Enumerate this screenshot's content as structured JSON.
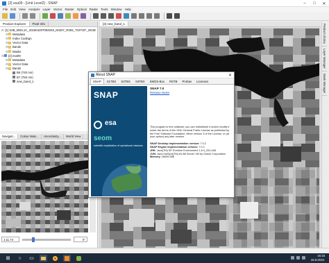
{
  "window": {
    "title": "[2] esa09 - [Unit Level2] - SNAP",
    "controls": [
      "–",
      "□",
      "✕"
    ]
  },
  "menu": [
    "File",
    "Edit",
    "View",
    "Analysis",
    "Layer",
    "Vector",
    "Raster",
    "Optical",
    "Radar",
    "Tools",
    "Window",
    "Help"
  ],
  "left_panel": {
    "tabs": [
      "Product Explorer",
      "Pixel Info"
    ],
    "tree": [
      {
        "label": "[1] S2B_MSIL1C_20180429T092029_N0207_R093_T34TGP_20180429",
        "depth": 0,
        "icon": "product-icon"
      },
      {
        "label": "Metadata",
        "depth": 1,
        "icon": "folder-icon"
      },
      {
        "label": "Index Codings",
        "depth": 1,
        "icon": "folder-icon"
      },
      {
        "label": "Vector Data",
        "depth": 1,
        "icon": "folder-icon"
      },
      {
        "label": "Bands",
        "depth": 1,
        "icon": "folder-icon"
      },
      {
        "label": "Masks",
        "depth": 1,
        "icon": "folder-icon"
      },
      {
        "label": "[2] esa09",
        "depth": 0,
        "icon": "product-icon"
      },
      {
        "label": "Metadata",
        "depth": 1,
        "icon": "folder-icon"
      },
      {
        "label": "Vector Data",
        "depth": 1,
        "icon": "folder-icon"
      },
      {
        "label": "Bands",
        "depth": 1,
        "icon": "folder-icon"
      },
      {
        "label": "B6 (740 nm)",
        "depth": 2,
        "icon": "band-icon"
      },
      {
        "label": "B7 (783 nm)",
        "depth": 2,
        "icon": "band-icon"
      },
      {
        "label": "new_band_1",
        "depth": 2,
        "icon": "band-icon"
      }
    ]
  },
  "nav_panel": {
    "tabs": [
      "Navigati...",
      "Colour Mani...",
      "Uncertainty...",
      "World View"
    ],
    "zoom_value": "1:11.74",
    "rotation_value": "0°"
  },
  "image_view": {
    "tab_label": "[2] new_band_1"
  },
  "right_bar": {
    "tabs": [
      "Product Library",
      "Layer Manager",
      "Mask Manager"
    ]
  },
  "about_dialog": {
    "title": "About SNAP",
    "tabs": [
      "SNAP",
      "S1TBX",
      "S2TBX",
      "S3TBX",
      "SMOS-Box",
      "RSTB",
      "Probav",
      "Licenses"
    ],
    "splash_text": "SNAP",
    "esa_label": "esa",
    "seom_label": "seom",
    "seom_tagline": "scientific exploitation of operational missions",
    "version": "SNAP 7.0",
    "release_notes": "Release Notes",
    "license_text": "This program is free software; you can redistribute it and/or modify it under the terms of the GNU General Public License as published by the Free Software Foundation; either version 3 of the License, or (at your option) any later version.",
    "impl": [
      {
        "key": "SNAP Desktop implementation version:",
        "value": "7.0.2"
      },
      {
        "key": "SNAP Engine implementation version:",
        "value": "7.0.2"
      },
      {
        "key": "JRE:",
        "value": "Java(TM) SE Runtime Environment 1.8.0_202-b08"
      },
      {
        "key": "JVM:",
        "value": "Java HotSpot(TM) 64-Bit Server VM by Oracle Corporation"
      },
      {
        "key": "Memory:",
        "value": "28055 MiB"
      }
    ]
  },
  "statusbar": {
    "items": [
      "",
      ""
    ]
  },
  "taskbar": {
    "time": "16:16",
    "date": "16.9.2019."
  },
  "colors": {
    "snap_blue": "#0d4a75",
    "link_blue": "#1a55c8",
    "taskbar": "#1d2a3a"
  }
}
